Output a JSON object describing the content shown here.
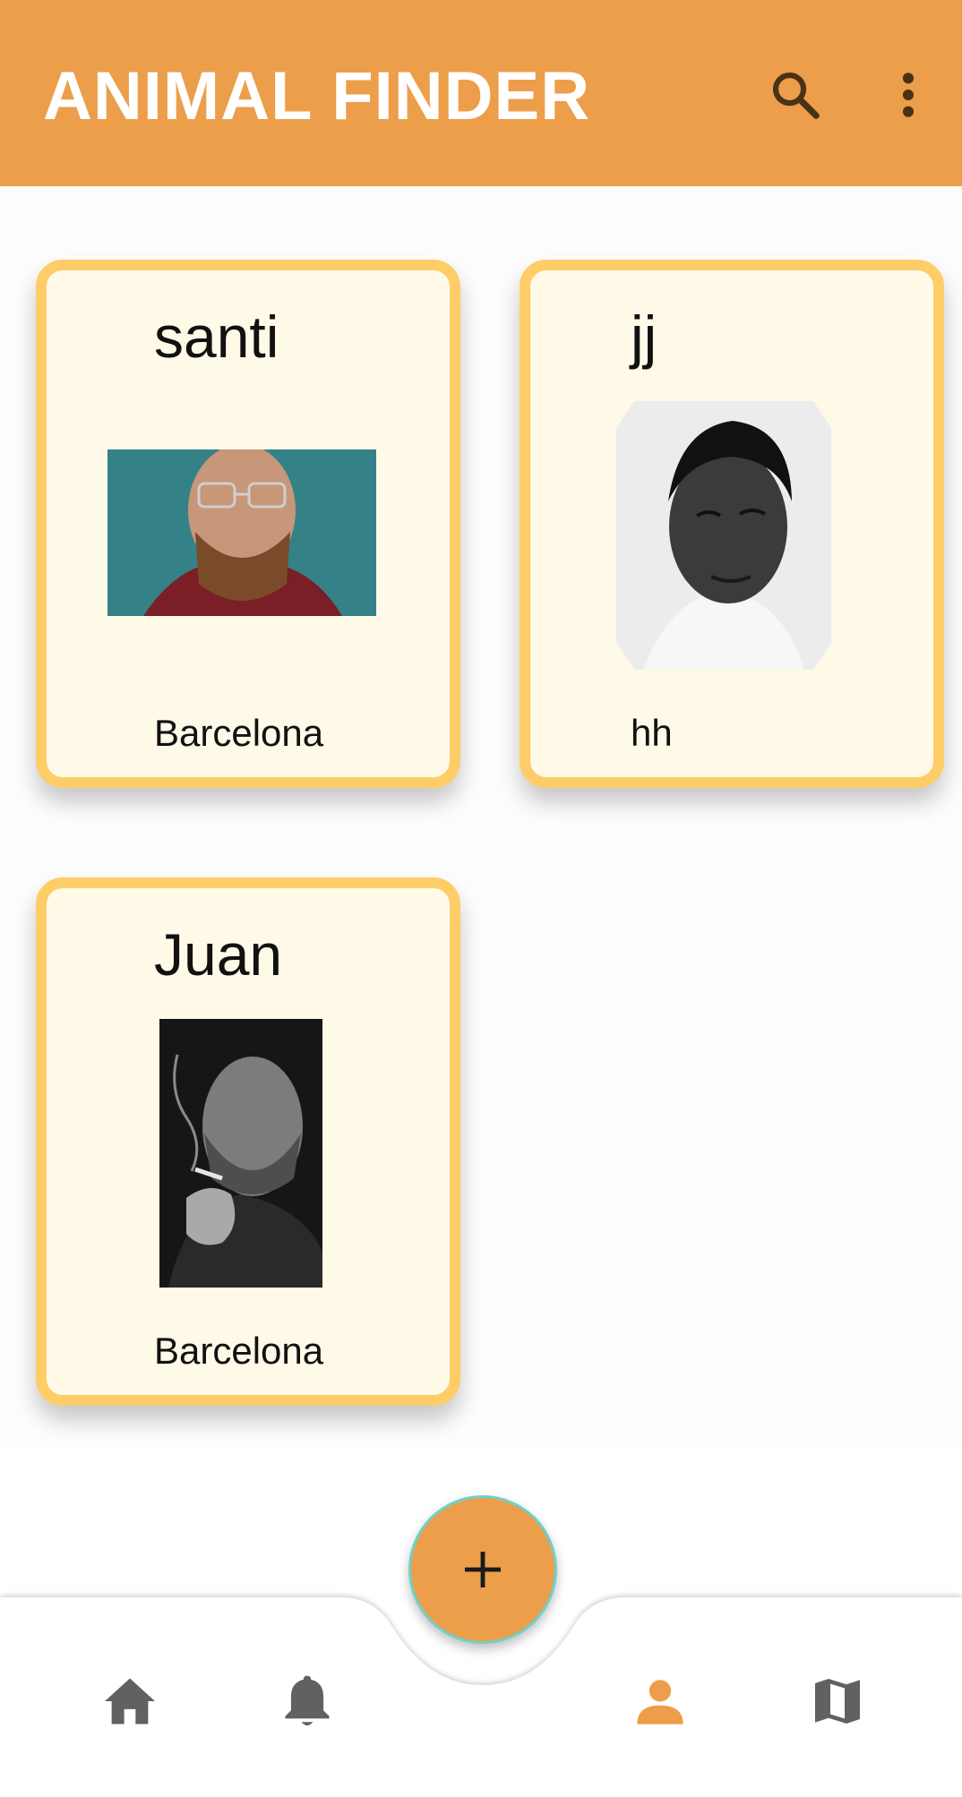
{
  "appbar": {
    "title": "ANIMAL FINDER",
    "background": "#EC9E4B",
    "icons": [
      "search-icon",
      "more-vert-icon"
    ]
  },
  "cards": [
    {
      "name": "santi",
      "location": "Barcelona",
      "photo": "photo of bald bearded man with glasses"
    },
    {
      "name": "jj",
      "location": "hh",
      "photo": "black-and-white portrait of young man"
    },
    {
      "name": "Juan",
      "location": "Barcelona",
      "photo": "black-and-white portrait of man smoking"
    }
  ],
  "fab": {
    "label": "+",
    "icon": "add-icon"
  },
  "bottom_nav": {
    "items": [
      "home-icon",
      "notifications-icon",
      "person-icon",
      "map-icon"
    ],
    "active": "person-icon",
    "active_color": "#EC9E4B",
    "inactive_color": "#616161"
  },
  "colors": {
    "card_border": "#FECD67",
    "card_background": "#FFF9E8",
    "fab_border": "#6FD1C8"
  }
}
